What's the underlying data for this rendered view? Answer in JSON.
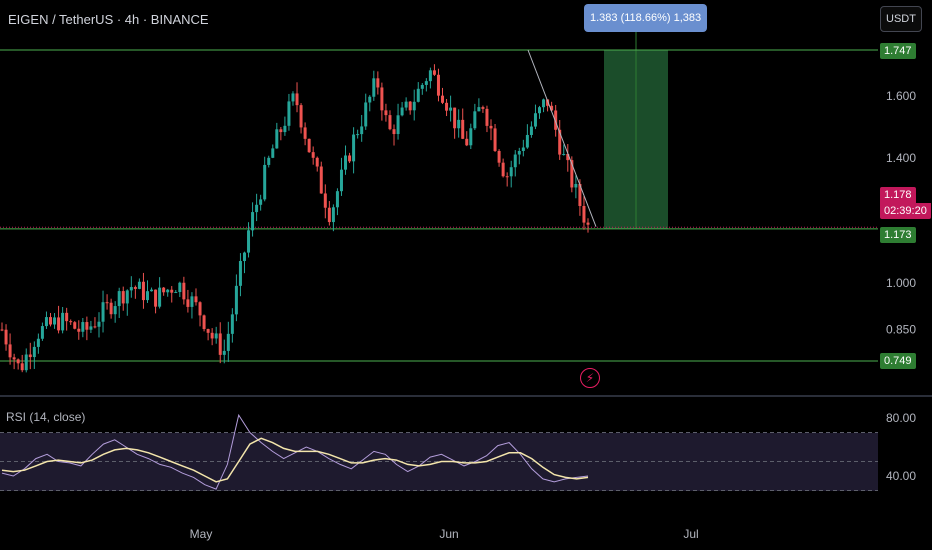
{
  "header": {
    "symbol": "EIGEN / TetherUS · 4h · BINANCE",
    "currency_button": "USDT"
  },
  "projection": {
    "label": "1.383 (118.66%) 1,383"
  },
  "price_badges": {
    "top_line": "1.747",
    "current_price": "1.178",
    "countdown": "02:39:20",
    "entry": "1.173",
    "bottom_line": "0.749"
  },
  "indicator": {
    "title": "RSI (14, close)"
  },
  "icons": {
    "alert": "lightning-icon"
  },
  "colors": {
    "up": "#26a69a",
    "down": "#ef5350",
    "hline": "#4caf50",
    "target_zone": "#1b4d2a",
    "projection_box": "#6a8fcf",
    "current_price_badge": "#c2185b",
    "rsi_line": "#b39ddb",
    "rsi_ma": "#f3e5ab"
  },
  "chart_data": [
    {
      "type": "candlestick",
      "title": "EIGEN / TetherUS · 4h · BINANCE",
      "y_axis_ticks": [
        "1.600",
        "1.400",
        "1.000",
        "0.850"
      ],
      "x_axis_ticks": [
        "May",
        "Jun",
        "Jul"
      ],
      "ylim": [
        0.68,
        1.88
      ],
      "horizontal_lines": [
        1.747,
        1.173,
        0.749
      ],
      "trendline": {
        "from": [
          1.747,
          "late May"
        ],
        "to": [
          1.18,
          "mid Jun"
        ]
      },
      "target_zone": {
        "from": 1.173,
        "to": 1.747
      },
      "last_price": 1.178,
      "series_path": [
        [
          0.0,
          0.85
        ],
        [
          0.03,
          0.72
        ],
        [
          0.06,
          0.84
        ],
        [
          0.1,
          0.88
        ],
        [
          0.14,
          0.84
        ],
        [
          0.19,
          0.94
        ],
        [
          0.22,
          0.99
        ],
        [
          0.26,
          0.95
        ],
        [
          0.3,
          1.0
        ],
        [
          0.34,
          0.9
        ],
        [
          0.36,
          0.82
        ],
        [
          0.38,
          0.78
        ],
        [
          0.42,
          1.16
        ],
        [
          0.46,
          1.42
        ],
        [
          0.5,
          1.6
        ],
        [
          0.53,
          1.39
        ],
        [
          0.56,
          1.22
        ],
        [
          0.6,
          1.46
        ],
        [
          0.64,
          1.65
        ],
        [
          0.66,
          1.48
        ],
        [
          0.7,
          1.58
        ],
        [
          0.73,
          1.68
        ],
        [
          0.75,
          1.62
        ],
        [
          0.79,
          1.44
        ],
        [
          0.82,
          1.58
        ],
        [
          0.86,
          1.34
        ],
        [
          0.9,
          1.49
        ],
        [
          0.93,
          1.59
        ],
        [
          0.96,
          1.39
        ],
        [
          1.0,
          1.18
        ]
      ]
    },
    {
      "type": "line",
      "title": "RSI (14, close)",
      "y_axis_ticks": [
        "80.00",
        "40.00"
      ],
      "ylim": [
        20,
        95
      ],
      "bands": [
        70,
        50,
        30
      ],
      "series": [
        {
          "values": [
            42,
            40,
            45,
            52,
            55,
            50,
            49,
            47,
            55,
            62,
            65,
            60,
            55,
            52,
            48,
            46,
            42,
            39,
            34,
            31,
            48,
            82,
            70,
            63,
            57,
            52,
            56,
            60,
            57,
            52,
            48,
            45,
            51,
            57,
            55,
            48,
            43,
            47,
            53,
            55,
            51,
            47,
            50,
            54,
            61,
            63,
            55,
            45,
            38,
            36,
            38,
            39,
            40
          ]
        },
        {
          "values": [
            44,
            43,
            44,
            47,
            50,
            51,
            50,
            49,
            51,
            55,
            58,
            59,
            58,
            56,
            53,
            50,
            47,
            44,
            40,
            36,
            38,
            50,
            62,
            66,
            63,
            59,
            57,
            57,
            57,
            55,
            52,
            49,
            49,
            51,
            52,
            51,
            48,
            47,
            48,
            50,
            50,
            49,
            49,
            50,
            53,
            56,
            56,
            52,
            46,
            41,
            39,
            38,
            39
          ]
        }
      ]
    }
  ]
}
